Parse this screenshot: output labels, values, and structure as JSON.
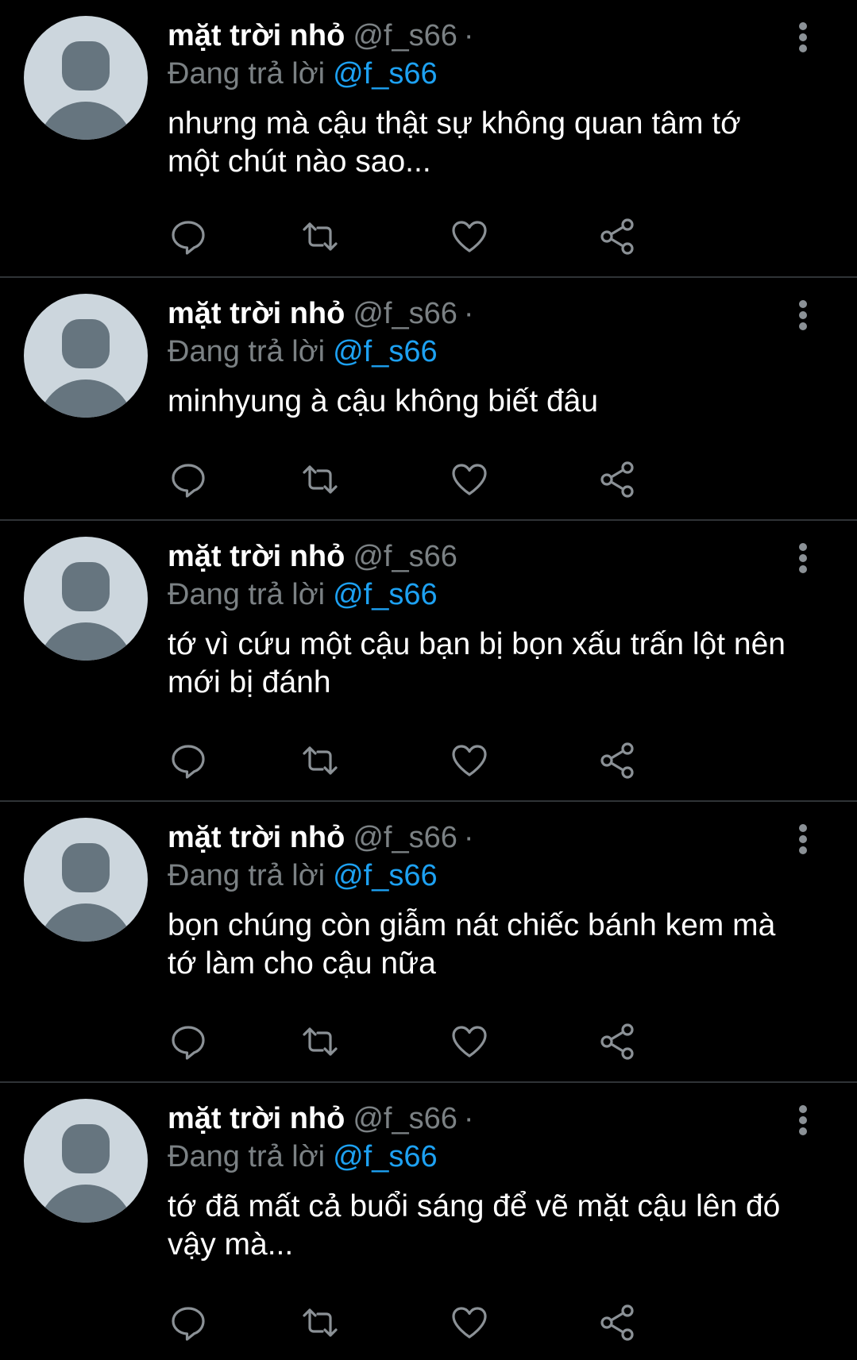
{
  "colors": {
    "background": "#000000",
    "name": "#ffffff",
    "muted": "#7b8184",
    "mention": "#1da1f2",
    "divider": "#2f3336",
    "avatar_bg": "#ccd6dd",
    "avatar_fg": "#66757f"
  },
  "tweets": [
    {
      "display_name": "mặt trời nhỏ",
      "handle": "@f_s66",
      "separator": "·",
      "reply_prefix": "Đang trả lời",
      "reply_to": "@f_s66",
      "text": "nhưng mà cậu thật sự không quan tâm tớ một chút nào sao..."
    },
    {
      "display_name": "mặt trời nhỏ",
      "handle": "@f_s66",
      "separator": "·",
      "reply_prefix": "Đang trả lời",
      "reply_to": "@f_s66",
      "text": "minhyung à cậu không biết đâu"
    },
    {
      "display_name": "mặt trời nhỏ",
      "handle": "@f_s66",
      "separator": "",
      "reply_prefix": "Đang trả lời",
      "reply_to": "@f_s66",
      "text": "tớ vì cứu một cậu bạn bị bọn xấu trấn lột nên mới bị đánh"
    },
    {
      "display_name": "mặt trời nhỏ",
      "handle": "@f_s66",
      "separator": "·",
      "reply_prefix": "Đang trả lời",
      "reply_to": "@f_s66",
      "text": "bọn chúng còn giẫm nát chiếc bánh kem mà tớ làm cho cậu nữa"
    },
    {
      "display_name": "mặt trời nhỏ",
      "handle": "@f_s66",
      "separator": "·",
      "reply_prefix": "Đang trả lời",
      "reply_to": "@f_s66",
      "text": "tớ đã mất cả buổi sáng để vẽ mặt cậu lên đó vậy mà..."
    }
  ],
  "action_icons": [
    "reply-icon",
    "retweet-icon",
    "like-icon",
    "share-icon"
  ],
  "more_icon": "more-vertical-icon",
  "avatar_icon": "default-avatar-icon"
}
